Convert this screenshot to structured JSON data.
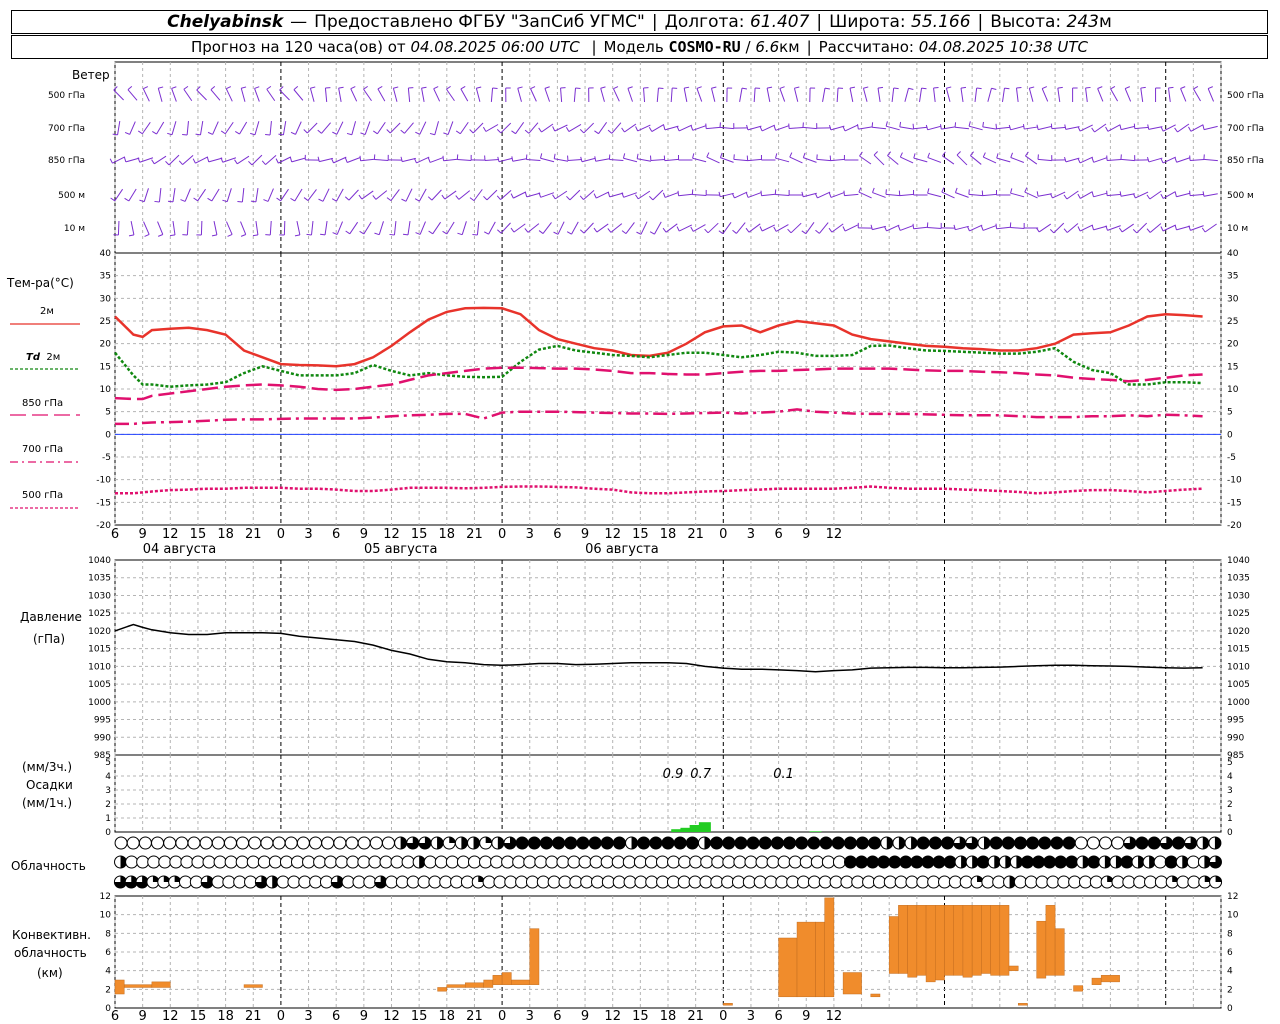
{
  "header": {
    "city": "Chelyabinsk",
    "dash": "—",
    "provider": "Предоставлено ФГБУ \"ЗапСиб УГМС\"",
    "lon_label": "Долгота:",
    "lon": "61.407",
    "lat_label": "Широта:",
    "lat": "55.166",
    "alt_label": "Высота:",
    "alt": "243",
    "alt_unit": "м",
    "forecast_prefix": "Прогноз на 120 часа(ов) от",
    "forecast_from": "04.08.2025 06:00 UTC",
    "model_label": "Модель",
    "model": "COSMO-RU",
    "resolution": "6.6",
    "resolution_unit": "км",
    "computed_label": "Рассчитано:",
    "computed": "04.08.2025 10:38 UTC"
  },
  "colors": {
    "wind": "#7b2fd0",
    "t2m": "#e8332b",
    "td2m": "#108810",
    "t850": "#e0106e",
    "t700": "#e0106e",
    "t500": "#e0106e",
    "zero_line": "#2040ff",
    "pressure": "#000000",
    "precip": "#22cc22",
    "convective": "#f08c2c",
    "grid": "#b4b4b4"
  },
  "labels": {
    "wind_title": "Ветер",
    "wind_levels": [
      "500 гПа",
      "700 гПа",
      "850 гПа",
      "500 м",
      "10 м"
    ],
    "temp_title": "Тем-ра(°C)",
    "t2m": "2м",
    "td_symbol": "Td",
    "td_level": "2м",
    "t850": "850 гПа",
    "t700": "700 гПа",
    "t500": "500 гПа",
    "pressure_title": "Давление",
    "pressure_unit": "(гПа)",
    "precip_unit3": "(мм/3ч.)",
    "precip_title": "Осадки",
    "precip_unit1": "(мм/1ч.)",
    "cloud_title": "Облачность",
    "conv_title1": "Конвективн.",
    "conv_title2": "облачность",
    "conv_unit": "(км)"
  },
  "chart_data": [
    {
      "type": "wind_barbs",
      "levels": [
        "500 гПа",
        "700 гПа",
        "850 гПа",
        "500 м",
        "10 м"
      ],
      "x_hours": "6 → 126 (hours from 04.08 00 UTC)"
    },
    {
      "type": "line",
      "title": "Тем-ра(°C)",
      "ylim": [
        -20,
        40
      ],
      "yticks": [
        -20,
        -15,
        -10,
        -5,
        0,
        5,
        10,
        15,
        20,
        25,
        30,
        35,
        40
      ],
      "xticks": [
        "6",
        "9",
        "12",
        "15",
        "18",
        "21",
        "0",
        "3",
        "6",
        "9",
        "12",
        "15",
        "18",
        "21",
        "0",
        "3",
        "6",
        "9",
        "12",
        "15",
        "18",
        "21",
        "0",
        "3",
        "6",
        "9",
        "12"
      ],
      "days": [
        "04 августа",
        "05 августа",
        "06 августа"
      ],
      "x": [
        6,
        8,
        9,
        10,
        12,
        14,
        16,
        18,
        20,
        22,
        24,
        26,
        28,
        30,
        32,
        34,
        36,
        38,
        40,
        42,
        44,
        46,
        48,
        50,
        52,
        54,
        56,
        58,
        60,
        62,
        64,
        66,
        68,
        70,
        72,
        74,
        76,
        78,
        80,
        82,
        84,
        86,
        88,
        90,
        92,
        94,
        96,
        98,
        100,
        102,
        104,
        106,
        108,
        110,
        112,
        114,
        116,
        118,
        120,
        122,
        124,
        126
      ],
      "series": [
        {
          "name": "2м",
          "key": "t2m",
          "style": "solid",
          "values": [
            26,
            22,
            21.5,
            23,
            23.3,
            23.5,
            23,
            22,
            18.5,
            17,
            15.5,
            15.3,
            15.2,
            15,
            15.5,
            17,
            19.5,
            22.5,
            25.3,
            27,
            27.8,
            27.9,
            27.8,
            26.5,
            23,
            21,
            20,
            19,
            18.5,
            17.5,
            17.3,
            18,
            20,
            22.5,
            23.8,
            24,
            22.5,
            24,
            25,
            24.5,
            24,
            22,
            21,
            20.5,
            20,
            19.5,
            19.3,
            19,
            18.8,
            18.5,
            18.5,
            19,
            20,
            22,
            22.3,
            22.5,
            24,
            26,
            26.5,
            26.3,
            26
          ]
        },
        {
          "name": "Td 2м",
          "key": "td2m",
          "style": "dotted",
          "values": [
            18,
            13,
            11,
            11,
            10.5,
            10.8,
            11,
            11.5,
            13.5,
            15,
            14,
            13,
            13,
            13,
            13.5,
            15.3,
            14,
            13,
            13.5,
            13,
            12.7,
            12.6,
            12.7,
            16,
            18.7,
            19.5,
            18.5,
            18,
            17.5,
            17.3,
            17,
            17.5,
            18,
            18,
            17.5,
            17,
            17.5,
            18.2,
            18,
            17.3,
            17.3,
            17.5,
            19.5,
            19.6,
            19,
            18.5,
            18.4,
            18.2,
            18,
            17.8,
            17.8,
            18.2,
            19,
            16,
            14.2,
            13.5,
            11,
            11,
            11.5,
            11.5,
            11.3
          ]
        },
        {
          "name": "850 гПа",
          "key": "t850",
          "style": "dash",
          "values": [
            8,
            7.8,
            7.8,
            8.5,
            9,
            9.5,
            10,
            10.5,
            10.8,
            11,
            10.8,
            10.5,
            10,
            9.8,
            10,
            10.5,
            11,
            12,
            13,
            13.5,
            14,
            14.5,
            14.7,
            14.7,
            14.6,
            14.5,
            14.5,
            14.3,
            14,
            13.5,
            13.5,
            13.3,
            13.2,
            13.2,
            13.5,
            13.8,
            14,
            14,
            14.2,
            14.3,
            14.5,
            14.5,
            14.5,
            14.5,
            14.3,
            14.1,
            14,
            14,
            13.8,
            13.7,
            13.5,
            13.2,
            13,
            12.5,
            12.2,
            12,
            11.7,
            12,
            12.5,
            13,
            13.2
          ]
        },
        {
          "name": "700 гПа",
          "key": "t700",
          "style": "dashdot",
          "values": [
            2.3,
            2.3,
            2.5,
            2.6,
            2.7,
            2.8,
            3,
            3.2,
            3.3,
            3.3,
            3.4,
            3.5,
            3.5,
            3.5,
            3.5,
            3.7,
            4,
            4.2,
            4.3,
            4.5,
            4.5,
            3.5,
            4.8,
            5,
            5,
            5,
            4.9,
            4.8,
            4.7,
            4.6,
            4.6,
            4.5,
            4.6,
            4.7,
            4.8,
            4.6,
            4.8,
            5,
            5.5,
            5,
            4.8,
            4.6,
            4.5,
            4.5,
            4.5,
            4.4,
            4.3,
            4.2,
            4.2,
            4.2,
            4,
            3.8,
            3.8,
            3.8,
            4,
            4,
            4.2,
            4,
            4.3,
            4.2,
            4
          ]
        },
        {
          "name": "500 гПа",
          "key": "t500",
          "style": "dotted",
          "values": [
            -13,
            -13,
            -12.8,
            -12.6,
            -12.3,
            -12.2,
            -12,
            -12,
            -11.8,
            -11.8,
            -11.8,
            -12,
            -12,
            -12.2,
            -12.5,
            -12.5,
            -12.2,
            -11.8,
            -11.8,
            -11.8,
            -11.9,
            -11.8,
            -11.6,
            -11.5,
            -11.5,
            -11.6,
            -11.7,
            -12,
            -12.2,
            -12.8,
            -13,
            -13,
            -12.8,
            -12.6,
            -12.5,
            -12.3,
            -12.2,
            -12,
            -12,
            -12,
            -12,
            -11.8,
            -11.5,
            -11.8,
            -12,
            -12,
            -12,
            -12.2,
            -12.3,
            -12.5,
            -12.7,
            -13,
            -12.8,
            -12.5,
            -12.3,
            -12.3,
            -12.5,
            -12.8,
            -12.5,
            -12.2,
            -12
          ]
        }
      ]
    },
    {
      "type": "line",
      "title": "Давление",
      "ylabel": "(гПа)",
      "ylim": [
        985,
        1040
      ],
      "yticks": [
        985,
        990,
        995,
        1000,
        1005,
        1010,
        1015,
        1020,
        1025,
        1030,
        1035,
        1040
      ],
      "x": [
        6,
        8,
        9,
        10,
        12,
        14,
        16,
        18,
        20,
        22,
        24,
        26,
        28,
        30,
        32,
        34,
        36,
        38,
        40,
        42,
        44,
        46,
        48,
        50,
        52,
        54,
        56,
        58,
        60,
        62,
        64,
        66,
        68,
        70,
        72,
        74,
        76,
        78,
        80,
        82,
        84,
        86,
        88,
        90,
        92,
        94,
        96,
        98,
        100,
        102,
        104,
        106,
        108,
        110,
        112,
        114,
        116,
        118,
        120,
        122,
        124,
        126
      ],
      "series": [
        {
          "name": "Давление",
          "key": "pressure",
          "values": [
            1020,
            1021.8,
            1021,
            1020.3,
            1019.5,
            1019,
            1019,
            1019.5,
            1019.5,
            1019.5,
            1019.3,
            1018.5,
            1018,
            1017.5,
            1017,
            1016,
            1014.5,
            1013.5,
            1012,
            1011.3,
            1011,
            1010.5,
            1010.3,
            1010.5,
            1010.8,
            1010.8,
            1010.5,
            1010.6,
            1010.8,
            1011,
            1011,
            1011,
            1010.8,
            1010,
            1009.5,
            1009.2,
            1009.2,
            1009,
            1008.8,
            1008.5,
            1008.8,
            1009,
            1009.5,
            1009.6,
            1009.7,
            1009.7,
            1009.6,
            1009.6,
            1009.7,
            1009.8,
            1010,
            1010.2,
            1010.3,
            1010.3,
            1010.2,
            1010.1,
            1010,
            1009.8,
            1009.6,
            1009.5,
            1009.6
          ]
        }
      ]
    },
    {
      "type": "bar",
      "title": "Осадки",
      "ylim": [
        0,
        5
      ],
      "yticks": [
        0,
        1,
        2,
        3,
        4,
        5
      ],
      "units": [
        "мм/3ч.",
        "мм/1ч."
      ],
      "x": [
        67,
        68,
        69,
        70,
        82
      ],
      "values": [
        0.2,
        0.3,
        0.5,
        0.7,
        0.05
      ],
      "annotations": [
        {
          "x": 66,
          "text": "0.9"
        },
        {
          "x": 69,
          "text": "0.7"
        },
        {
          "x": 78,
          "text": "0.1"
        }
      ]
    },
    {
      "type": "cloud_cover",
      "rows": 3,
      "note": "fraction of circle filled per time step (0..1)",
      "x_start": 6,
      "x_end": 126,
      "top": [
        0,
        0,
        0,
        0,
        0,
        0,
        0,
        0,
        0,
        0,
        0,
        0,
        0,
        0,
        0,
        0,
        0,
        0,
        0,
        0,
        0,
        0,
        0,
        0.5,
        0.75,
        0.75,
        0.5,
        0.25,
        0.5,
        0.5,
        0.25,
        0.5,
        0.75,
        1,
        1,
        1,
        1,
        1,
        1,
        1,
        1,
        1,
        0.5,
        1,
        1,
        1,
        1,
        1,
        0.5,
        1,
        1,
        1,
        1,
        1,
        1,
        1,
        1,
        1,
        1,
        1,
        1,
        1,
        1,
        0.5,
        0.5,
        0.5,
        1,
        1,
        1,
        0.75,
        0.75,
        0.5,
        1,
        1,
        1,
        1,
        1,
        1,
        1,
        0,
        0,
        0,
        0,
        0.75,
        1,
        1,
        0.75,
        1,
        0.75,
        0.5,
        0.5
      ],
      "mid": [
        0.5,
        0,
        0,
        0,
        0,
        0,
        0,
        0,
        0,
        0,
        0,
        0,
        0,
        0,
        0,
        0,
        0,
        0,
        0,
        0,
        0,
        0,
        0,
        0,
        0,
        0,
        0,
        0.5,
        0,
        0,
        0,
        0,
        0,
        0,
        0,
        0,
        0,
        0,
        0,
        0,
        0,
        0,
        0,
        0,
        0,
        0,
        0,
        0,
        0,
        0,
        0,
        0,
        0,
        0,
        0,
        0,
        0,
        0,
        0,
        0,
        0,
        0,
        0,
        0,
        0,
        0,
        1,
        1,
        1,
        1,
        1,
        1,
        1,
        1,
        1,
        1,
        0.5,
        0.5,
        1,
        0.5,
        0.5,
        0.5,
        1,
        1,
        1,
        1,
        1,
        0.5,
        1,
        0.5,
        0.5,
        1,
        0.5,
        0.5,
        0,
        1,
        0.5,
        0,
        0.5,
        0.75
      ],
      "low": [
        0.75,
        0.75,
        0.75,
        0.25,
        0.25,
        0.25,
        0,
        0,
        0.75,
        0,
        0,
        0,
        0,
        0.75,
        0.5,
        0,
        0,
        0,
        0,
        0,
        0.75,
        0,
        0,
        0,
        0.75,
        0,
        0,
        0,
        0,
        0,
        0,
        0,
        0,
        0.25,
        0,
        0,
        0,
        0,
        0,
        0,
        0,
        0,
        0,
        0,
        0,
        0,
        0,
        0,
        0,
        0,
        0,
        0,
        0,
        0,
        0,
        0,
        0,
        0,
        0,
        0,
        0,
        0,
        0,
        0,
        0,
        0,
        0,
        0,
        0,
        0,
        0,
        0,
        0,
        0,
        0,
        0,
        0,
        0,
        0,
        0.25,
        0,
        0,
        0.5,
        0,
        0,
        0,
        0,
        0,
        0,
        0,
        0,
        0.25,
        0,
        0,
        0,
        0,
        0,
        0.25,
        0,
        0,
        0.25,
        0.25
      ]
    },
    {
      "type": "bar",
      "title": "Конвективн. облачность",
      "ylabel": "(км)",
      "ylim": [
        0,
        12
      ],
      "yticks": [
        0,
        2,
        4,
        6,
        8,
        10,
        12
      ],
      "ranges_km": [
        [
          6,
          7,
          1.5,
          3
        ],
        [
          7,
          10,
          2.2,
          2.5
        ],
        [
          10,
          12,
          2.2,
          2.8
        ],
        [
          20,
          22,
          2.2,
          2.5
        ],
        [
          41,
          42,
          1.8,
          2.2
        ],
        [
          42,
          44,
          2.2,
          2.5
        ],
        [
          44,
          46,
          2.2,
          2.7
        ],
        [
          46,
          47,
          2.2,
          3
        ],
        [
          47,
          48,
          2.5,
          3.5
        ],
        [
          48,
          49,
          2.5,
          3.8
        ],
        [
          49,
          51,
          2.5,
          3
        ],
        [
          51,
          52,
          2.5,
          8.5
        ],
        [
          72,
          73,
          0.3,
          0.5
        ],
        [
          78,
          80,
          1.2,
          7.5
        ],
        [
          80,
          82,
          1.2,
          9.2
        ],
        [
          82,
          83,
          1.2,
          9.2
        ],
        [
          83,
          84,
          1.2,
          11.8
        ],
        [
          85,
          87,
          1.5,
          3.8
        ],
        [
          88,
          89,
          1.2,
          1.5
        ],
        [
          90,
          91,
          3.7,
          9.8
        ],
        [
          91,
          92,
          3.7,
          11
        ],
        [
          92,
          93,
          3.3,
          11
        ],
        [
          93,
          94,
          3.5,
          11
        ],
        [
          94,
          95,
          2.8,
          11
        ],
        [
          95,
          96,
          3,
          11
        ],
        [
          96,
          97,
          3.5,
          11
        ],
        [
          97,
          98,
          3.5,
          11
        ],
        [
          98,
          99,
          3.3,
          11
        ],
        [
          99,
          100,
          3.5,
          11
        ],
        [
          100,
          101,
          3.7,
          11
        ],
        [
          101,
          102,
          3.5,
          11
        ],
        [
          102,
          103,
          3.5,
          11
        ],
        [
          103,
          104,
          4,
          4.5
        ],
        [
          104,
          105,
          0.3,
          0.5
        ],
        [
          106,
          107,
          3.2,
          9.3
        ],
        [
          107,
          108,
          3.5,
          11
        ],
        [
          108,
          109,
          3.5,
          8.5
        ],
        [
          110,
          111,
          1.8,
          2.4
        ],
        [
          112,
          113,
          2.5,
          3.2
        ],
        [
          113,
          115,
          2.8,
          3.5
        ]
      ]
    }
  ]
}
